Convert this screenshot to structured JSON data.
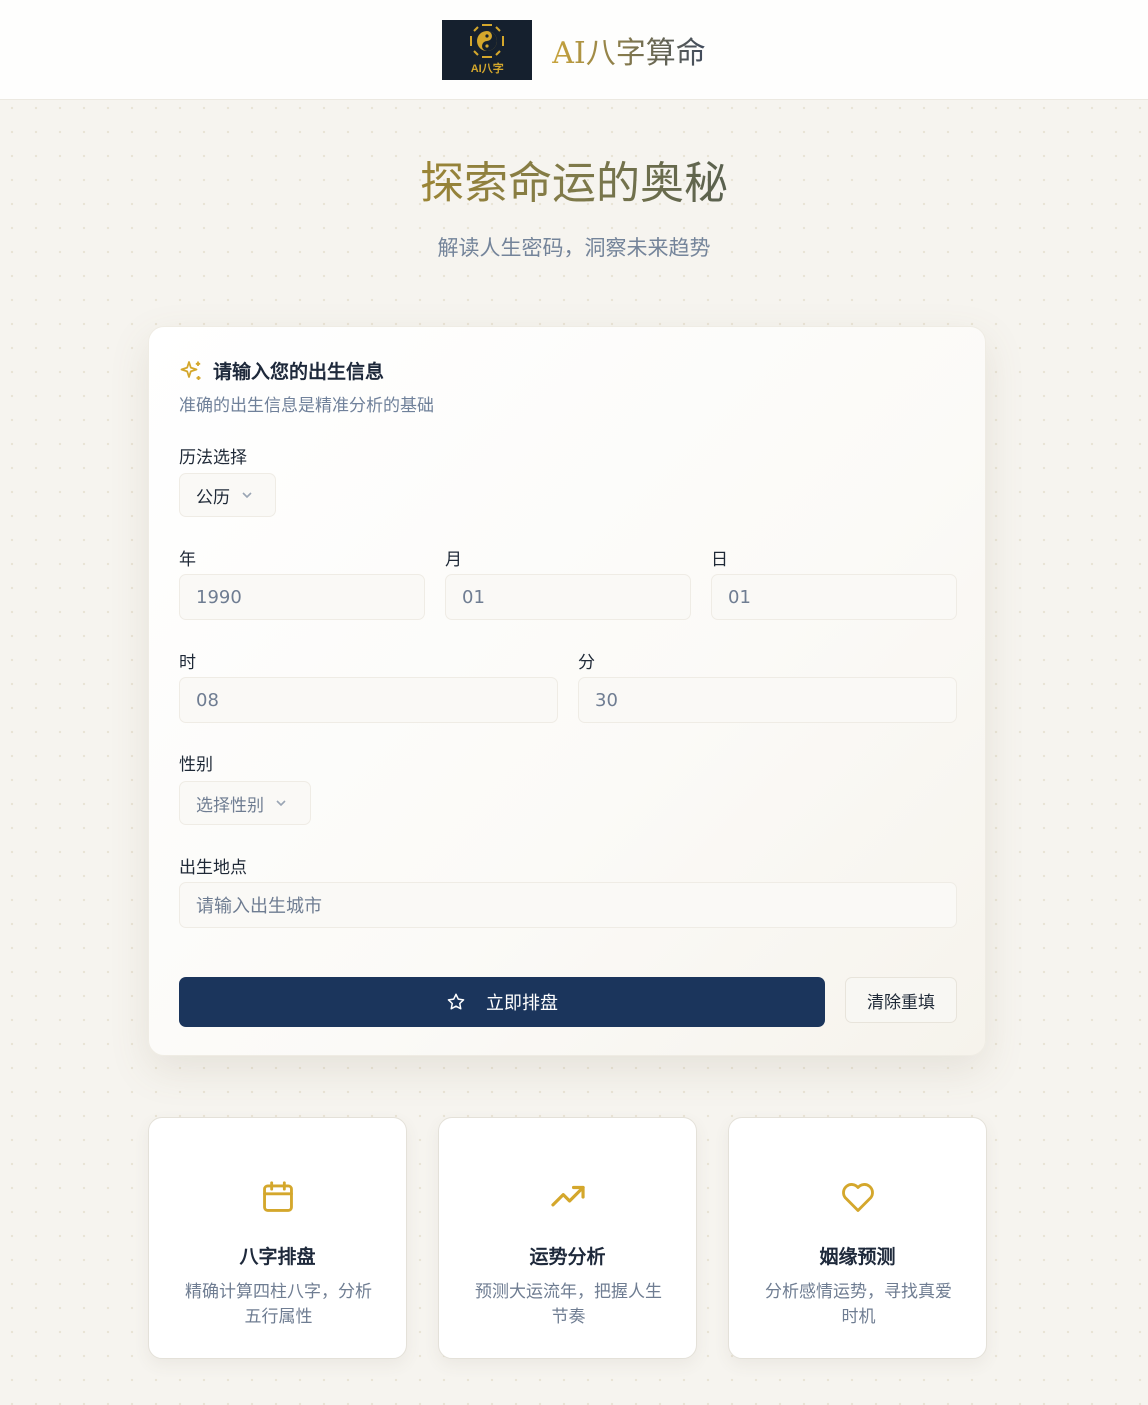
{
  "header": {
    "logo_text": "AI八字",
    "brand": "AI八字算命"
  },
  "hero": {
    "title": "探索命运的奥秘",
    "subtitle": "解读人生密码，洞察未来趋势"
  },
  "form": {
    "title": "请输入您的出生信息",
    "description": "准确的出生信息是精准分析的基础",
    "calendar": {
      "label": "历法选择",
      "value": "公历"
    },
    "year": {
      "label": "年",
      "value": "1990"
    },
    "month": {
      "label": "月",
      "value": "01"
    },
    "day": {
      "label": "日",
      "value": "01"
    },
    "hour": {
      "label": "时",
      "value": "08"
    },
    "minute": {
      "label": "分",
      "value": "30"
    },
    "gender": {
      "label": "性别",
      "placeholder": "选择性别"
    },
    "birthplace": {
      "label": "出生地点",
      "placeholder": "请输入出生城市"
    },
    "submit_label": "立即排盘",
    "reset_label": "清除重填"
  },
  "features": [
    {
      "icon": "calendar-icon",
      "title": "八字排盘",
      "description": "精确计算四柱八字，分析五行属性"
    },
    {
      "icon": "trending-up-icon",
      "title": "运势分析",
      "description": "预测大运流年，把握人生节奏"
    },
    {
      "icon": "heart-icon",
      "title": "姻缘预测",
      "description": "分析感情运势，寻找真爱时机"
    }
  ],
  "colors": {
    "accent_gold": "#d4a72c",
    "primary_navy": "#1b355c",
    "background": "#f6f4ef"
  }
}
